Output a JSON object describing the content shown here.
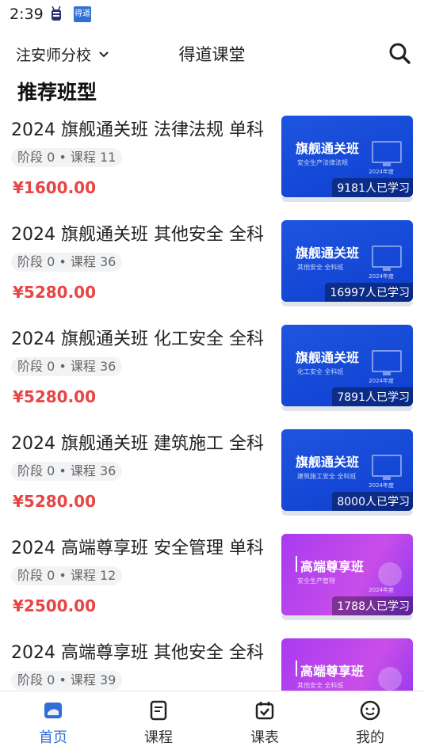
{
  "status_bar": {
    "time": "2:39",
    "icon_text": "得道"
  },
  "header": {
    "school": "注安师分校",
    "title": "得道课堂"
  },
  "section": {
    "title": "推荐班型"
  },
  "courses": [
    {
      "title": "2024 旗舰通关班 法律法规 单科",
      "meta": "阶段 0 • 课程 11",
      "price": "¥1600.00",
      "cover": {
        "title": "旗舰通关班",
        "subtitle": "安全生产法律法规",
        "year": "2024年度",
        "learners": "9181人已学习",
        "theme": "blue"
      }
    },
    {
      "title": "2024 旗舰通关班 其他安全 全科",
      "meta": "阶段 0 • 课程 36",
      "price": "¥5280.00",
      "cover": {
        "title": "旗舰通关班",
        "subtitle": "其他安全 全科班",
        "year": "2024年度",
        "learners": "16997人已学习",
        "theme": "blue"
      }
    },
    {
      "title": "2024 旗舰通关班 化工安全 全科",
      "meta": "阶段 0 • 课程 36",
      "price": "¥5280.00",
      "cover": {
        "title": "旗舰通关班",
        "subtitle": "化工安全 全科班",
        "year": "2024年度",
        "learners": "7891人已学习",
        "theme": "blue"
      }
    },
    {
      "title": "2024 旗舰通关班 建筑施工 全科",
      "meta": "阶段 0 • 课程 36",
      "price": "¥5280.00",
      "cover": {
        "title": "旗舰通关班",
        "subtitle": "建筑施工安全 全科班",
        "year": "2024年度",
        "learners": "8000人已学习",
        "theme": "blue"
      }
    },
    {
      "title": "2024 高端尊享班 安全管理 单科",
      "meta": "阶段 0 • 课程 12",
      "price": "¥2500.00",
      "cover": {
        "title": "高端尊享班",
        "subtitle": "安全生产管理",
        "year": "2024年度",
        "learners": "1788人已学习",
        "theme": "purple"
      }
    },
    {
      "title": "2024 高端尊享班 其他安全 全科",
      "meta": "阶段 0 • 课程 39",
      "price": "",
      "cover": {
        "title": "高端尊享班",
        "subtitle": "其他安全 全科班",
        "year": "",
        "learners": "",
        "theme": "purple"
      }
    }
  ],
  "tabs": [
    {
      "label": "首页",
      "icon": "home-icon",
      "active": true
    },
    {
      "label": "课程",
      "icon": "course-icon",
      "active": false
    },
    {
      "label": "课表",
      "icon": "schedule-icon",
      "active": false
    },
    {
      "label": "我的",
      "icon": "profile-icon",
      "active": false
    }
  ],
  "colors": {
    "accent": "#2f6fd6",
    "price": "#e84545",
    "cover_blue": "#1148d6",
    "cover_purple": "#b043ee"
  }
}
